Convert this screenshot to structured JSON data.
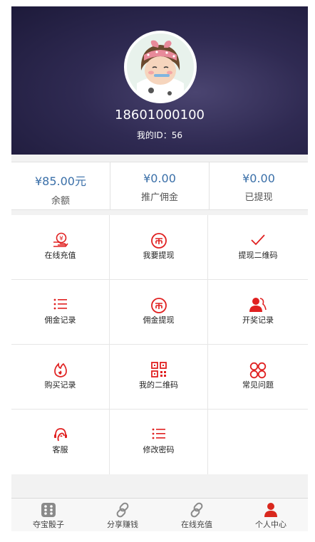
{
  "profile": {
    "phone": "18601000100",
    "id_label": "我的ID：",
    "id_value": "56"
  },
  "stats": [
    {
      "value": "¥85.00元",
      "label": "余额"
    },
    {
      "value": "¥0.00",
      "label": "推广佣金"
    },
    {
      "value": "¥0.00",
      "label": "已提现"
    }
  ],
  "menu": [
    {
      "label": "在线充值",
      "icon": "recharge-icon"
    },
    {
      "label": "我要提现",
      "icon": "withdraw-icon"
    },
    {
      "label": "提现二维码",
      "icon": "checkmark-icon"
    },
    {
      "label": "佣金记录",
      "icon": "list-icon"
    },
    {
      "label": "佣金提现",
      "icon": "withdraw-icon"
    },
    {
      "label": "开奖记录",
      "icon": "users-icon"
    },
    {
      "label": "购买记录",
      "icon": "fire-icon"
    },
    {
      "label": "我的二维码",
      "icon": "qrcode-icon"
    },
    {
      "label": "常见问题",
      "icon": "circles-icon"
    },
    {
      "label": "客服",
      "icon": "headset-icon"
    },
    {
      "label": "修改密码",
      "icon": "list-icon"
    }
  ],
  "tabs": [
    {
      "label": "夺宝骰子",
      "icon": "dice-icon"
    },
    {
      "label": "分享赚钱",
      "icon": "link-icon"
    },
    {
      "label": "在线充值",
      "icon": "link-icon"
    },
    {
      "label": "个人中心",
      "icon": "person-icon"
    }
  ],
  "colors": {
    "accent_red": "#e02020",
    "stat_blue": "#3a6fa8",
    "header_dark": "#2f2a52",
    "tab_active": "#d9281e"
  }
}
